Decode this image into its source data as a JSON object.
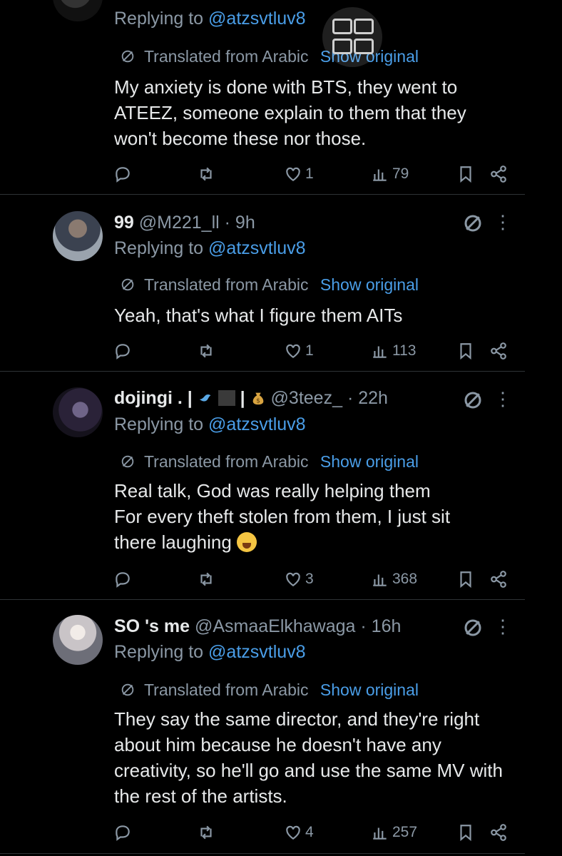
{
  "tweets": [
    {
      "name": "",
      "handle": "",
      "time": "",
      "replying_prefix": "Replying to",
      "replying_to": "@atzsvtluv8",
      "translated": "Translated from Arabic",
      "show_original": "Show original",
      "body": "My anxiety is done with BTS, they went to ATEEZ, someone explain to them that they won't become these nor those.",
      "likes": "1",
      "views": "79"
    },
    {
      "name": "99",
      "handle": "@M221_ll",
      "time": "· 9h",
      "replying_prefix": "Replying to",
      "replying_to": "@atzsvtluv8",
      "translated": "Translated from Arabic",
      "show_original": "Show original",
      "body": "Yeah, that's what I figure them AITs",
      "likes": "1",
      "views": "113"
    },
    {
      "name": "dojingi . |",
      "name_tail": "|",
      "handle": "@3teez_",
      "time": "· 22h",
      "replying_prefix": "Replying to",
      "replying_to": "@atzsvtluv8",
      "translated": "Translated from Arabic",
      "show_original": "Show original",
      "body_line1": "Real talk, God was really helping them",
      "body_line2": "For every theft stolen from them, I just sit there laughing",
      "likes": "3",
      "views": "368"
    },
    {
      "name": "SO 's me",
      "handle": "@AsmaaElkhawaga",
      "time": "· 16h",
      "replying_prefix": "Replying to",
      "replying_to": "@atzsvtluv8",
      "translated": "Translated from Arabic",
      "show_original": "Show original",
      "body": "They say the same director, and they're right about him because he doesn't have any creativity, so he'll go and use the same MV with the rest of the artists.",
      "likes": "4",
      "views": "257"
    }
  ],
  "more_label": "⋮",
  "icons": [
    "reply-icon",
    "retweet-icon",
    "heart-icon",
    "views-icon",
    "bookmark-icon",
    "share-icon",
    "grok-icon",
    "translate-globe-icon"
  ],
  "colors": {
    "background": "#000000",
    "text": "#e7e9ea",
    "muted": "#8b98a5",
    "link": "#4a9ee8",
    "divider": "#2f3336"
  }
}
